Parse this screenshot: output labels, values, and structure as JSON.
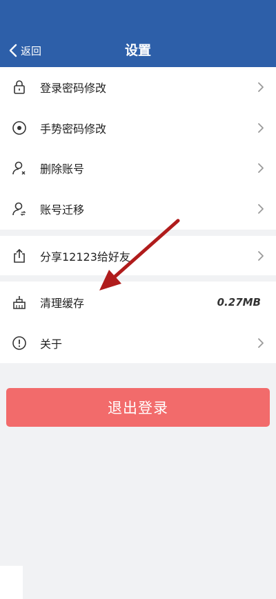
{
  "header": {
    "back_label": "返回",
    "title": "设置",
    "bg_color": "#2d5fa9"
  },
  "groups": [
    {
      "items": [
        {
          "label": "登录密码修改",
          "icon": "lock-icon"
        },
        {
          "label": "手势密码修改",
          "icon": "target-icon"
        },
        {
          "label": "删除账号",
          "icon": "user-remove-icon"
        },
        {
          "label": "账号迁移",
          "icon": "user-transfer-icon"
        }
      ]
    },
    {
      "items": [
        {
          "label": "分享12123给好友",
          "icon": "share-icon"
        }
      ]
    },
    {
      "items": [
        {
          "label": "清理缓存",
          "icon": "broom-icon",
          "value": "0.27MB"
        },
        {
          "label": "关于",
          "icon": "info-icon"
        }
      ]
    }
  ],
  "logout": {
    "label": "退出登录",
    "color": "#f26b6b"
  },
  "annotation": {
    "arrow_color": "#b01c1c"
  }
}
